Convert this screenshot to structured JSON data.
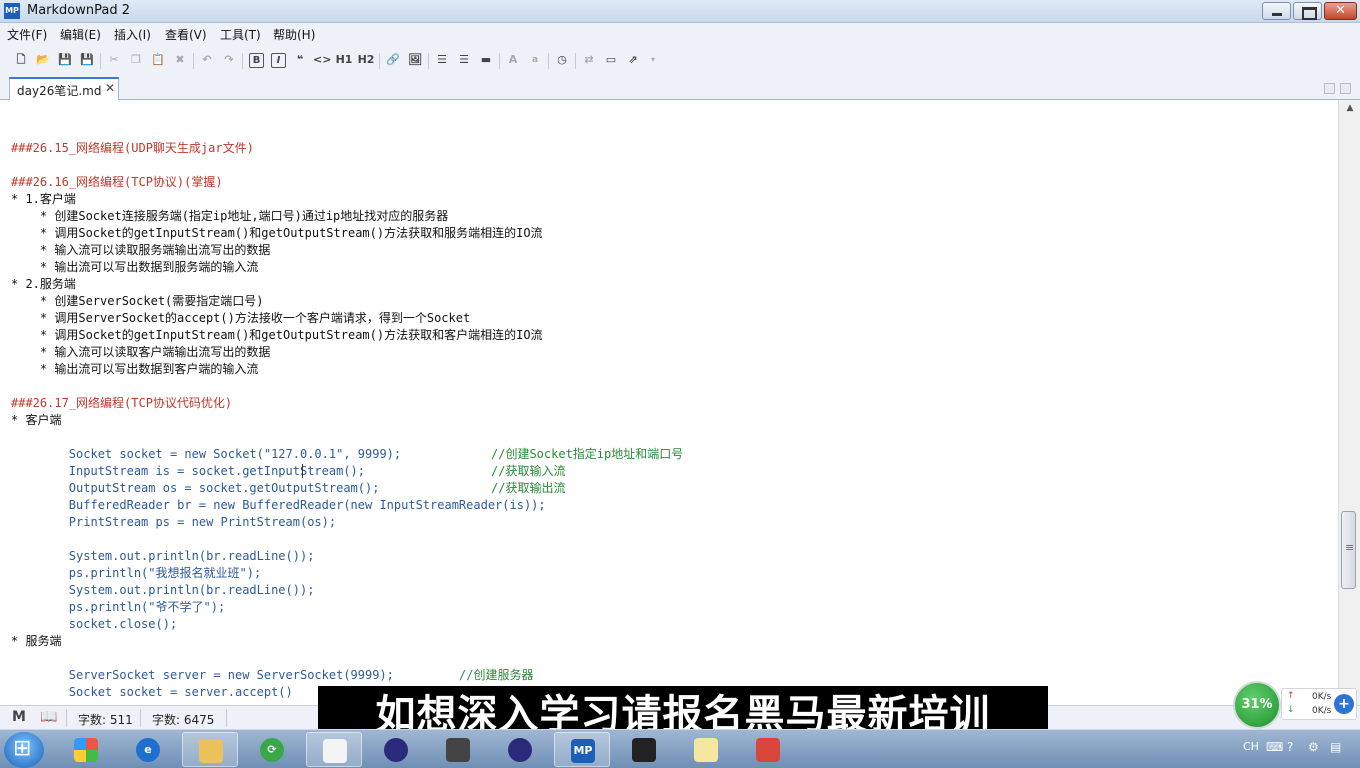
{
  "app": {
    "title": "MarkdownPad 2",
    "icon_text": "MP"
  },
  "menu": [
    {
      "label": "文件(F)"
    },
    {
      "label": "编辑(E)"
    },
    {
      "label": "插入(I)"
    },
    {
      "label": "查看(V)"
    },
    {
      "label": "工具(T)"
    },
    {
      "label": "帮助(H)"
    }
  ],
  "toolbar": {
    "bold": "B",
    "italic": "I",
    "quote": "❝",
    "code": "<>",
    "h1": "H1",
    "h2": "H2",
    "font_large": "A",
    "font_small": "a"
  },
  "tab": {
    "label": "day26笔记.md",
    "close": "✕"
  },
  "editor": {
    "lines": [
      {
        "text": "###26.15_网络编程(UDP聊天生成jar文件)",
        "kind": "head"
      },
      {
        "text": "###26.16_网络编程(TCP协议)(掌握)",
        "kind": "head"
      },
      {
        "text": "* 1.客户端",
        "kind": "bul"
      },
      {
        "text": "    * 创建Socket连接服务端(指定ip地址,端口号)通过ip地址找对应的服务器",
        "kind": "bul"
      },
      {
        "text": "    * 调用Socket的getInputStream()和getOutputStream()方法获取和服务端相连的IO流",
        "kind": "bul"
      },
      {
        "text": "    * 输入流可以读取服务端输出流写出的数据",
        "kind": "bul"
      },
      {
        "text": "    * 输出流可以写出数据到服务端的输入流",
        "kind": "bul"
      },
      {
        "text": "* 2.服务端",
        "kind": "bul"
      },
      {
        "text": "    * 创建ServerSocket(需要指定端口号)",
        "kind": "bul"
      },
      {
        "text": "    * 调用ServerSocket的accept()方法接收一个客户端请求，得到一个Socket",
        "kind": "bul"
      },
      {
        "text": "    * 调用Socket的getInputStream()和getOutputStream()方法获取和客户端相连的IO流",
        "kind": "bul"
      },
      {
        "text": "    * 输入流可以读取客户端输出流写出的数据",
        "kind": "bul"
      },
      {
        "text": "    * 输出流可以写出数据到客户端的输入流",
        "kind": "bul"
      },
      {
        "text": "###26.17_网络编程(TCP协议代码优化)",
        "kind": "head"
      },
      {
        "text": "* 客户端",
        "kind": "bul"
      },
      {
        "text": "        Socket socket = new Socket(\"127.0.0.1\", 9999);",
        "kind": "code"
      },
      {
        "text": "//创建Socket指定ip地址和端口号",
        "kind": "cmt"
      },
      {
        "text": "        InputStream is = socket.getInputStream();",
        "kind": "code"
      },
      {
        "text": "//获取输入流",
        "kind": "cmt"
      },
      {
        "text": "        OutputStream os = socket.getOutputStream();",
        "kind": "code"
      },
      {
        "text": "//获取输出流",
        "kind": "cmt"
      },
      {
        "text": "        BufferedReader br = new BufferedReader(new InputStreamReader(is));",
        "kind": "code"
      },
      {
        "text": "        PrintStream ps = new PrintStream(os);",
        "kind": "code"
      },
      {
        "text": "        System.out.println(br.readLine());",
        "kind": "code"
      },
      {
        "text": "        ps.println(\"我想报名就业班\");",
        "kind": "code"
      },
      {
        "text": "        System.out.println(br.readLine());",
        "kind": "code"
      },
      {
        "text": "        ps.println(\"爷不学了\");",
        "kind": "code"
      },
      {
        "text": "        socket.close();",
        "kind": "code"
      },
      {
        "text": "* 服务端",
        "kind": "bul"
      },
      {
        "text": "        ServerSocket server = new ServerSocket(9999);",
        "kind": "code"
      },
      {
        "text": "//创建服务器",
        "kind": "cmt"
      },
      {
        "text": "        Socket socket = server.accept()",
        "kind": "code"
      }
    ]
  },
  "status": {
    "words_label": "字数: 511",
    "chars_label": "字数: 6475"
  },
  "caption": "如想深入学习请报名黑马最新培训",
  "network": {
    "percent": "31%",
    "up": "0K/s",
    "down": "0K/s",
    "plus": "+"
  },
  "taskbar": {
    "lang": "CH"
  },
  "colors": {
    "heading": "#c0392b",
    "code": "#2e5a9a",
    "comment": "#2a8a3a",
    "tab_accent": "#3d7ad6"
  }
}
